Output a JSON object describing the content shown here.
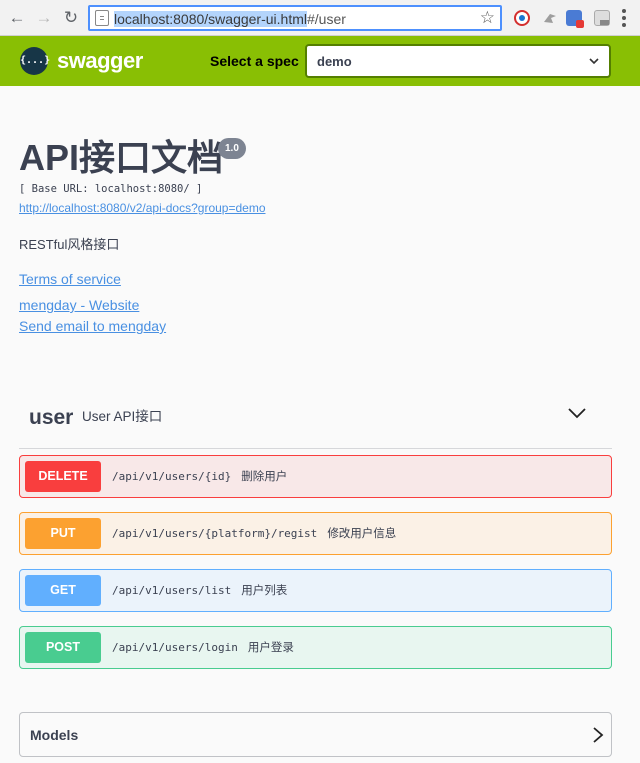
{
  "browser": {
    "url_selected": "localhost:8080/swagger-ui.html",
    "url_rest": "#/user",
    "icons": [
      "back-arrow-icon",
      "forward-arrow-icon",
      "reload-icon",
      "page-info-icon",
      "bookmark-star-icon",
      "extension-icon",
      "menu-icon"
    ]
  },
  "topbar": {
    "logo_glyph": "{...}",
    "brand": "swagger",
    "spec_label": "Select a spec",
    "spec_value": "demo",
    "color": "#89bf04"
  },
  "info": {
    "title": "API接口文档",
    "version": "1.0",
    "base_url": "[ Base URL: localhost:8080/ ]",
    "docs_url": "http://localhost:8080/v2/api-docs?group=demo",
    "description": "RESTful风格接口",
    "terms": "Terms of service",
    "website": "mengday - Website",
    "email": "Send email to mengday"
  },
  "tag": {
    "name": "user",
    "description": "User API接口"
  },
  "operations": [
    {
      "method": "DELETE",
      "path": "/api/v1/users/{id}",
      "summary": "删除用户",
      "color": "#f93e3e"
    },
    {
      "method": "PUT",
      "path": "/api/v1/users/{platform}/regist",
      "summary": "修改用户信息",
      "color": "#fca130"
    },
    {
      "method": "GET",
      "path": "/api/v1/users/list",
      "summary": "用户列表",
      "color": "#61affe"
    },
    {
      "method": "POST",
      "path": "/api/v1/users/login",
      "summary": "用户登录",
      "color": "#49cc90"
    }
  ],
  "models": {
    "title": "Models"
  }
}
